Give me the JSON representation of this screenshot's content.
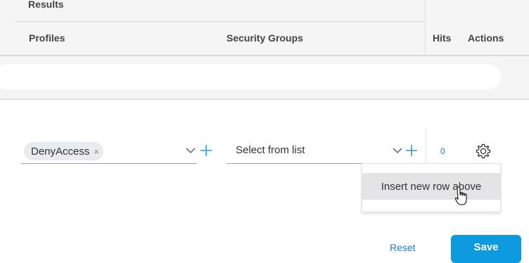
{
  "header": {
    "results_label": "Results",
    "columns": {
      "profiles": "Profiles",
      "security_groups": "Security Groups",
      "hits": "Hits",
      "actions": "Actions"
    }
  },
  "row": {
    "profile_tag": "DenyAccess",
    "profile_tag_remove": "×",
    "security_group_placeholder": "Select from list",
    "hits": "0"
  },
  "context_menu": {
    "items": [
      "Insert new row above"
    ]
  },
  "footer": {
    "reset_label": "Reset",
    "save_label": "Save"
  },
  "colors": {
    "accent": "#1a7ecb",
    "primary_button": "#0d9be0"
  }
}
